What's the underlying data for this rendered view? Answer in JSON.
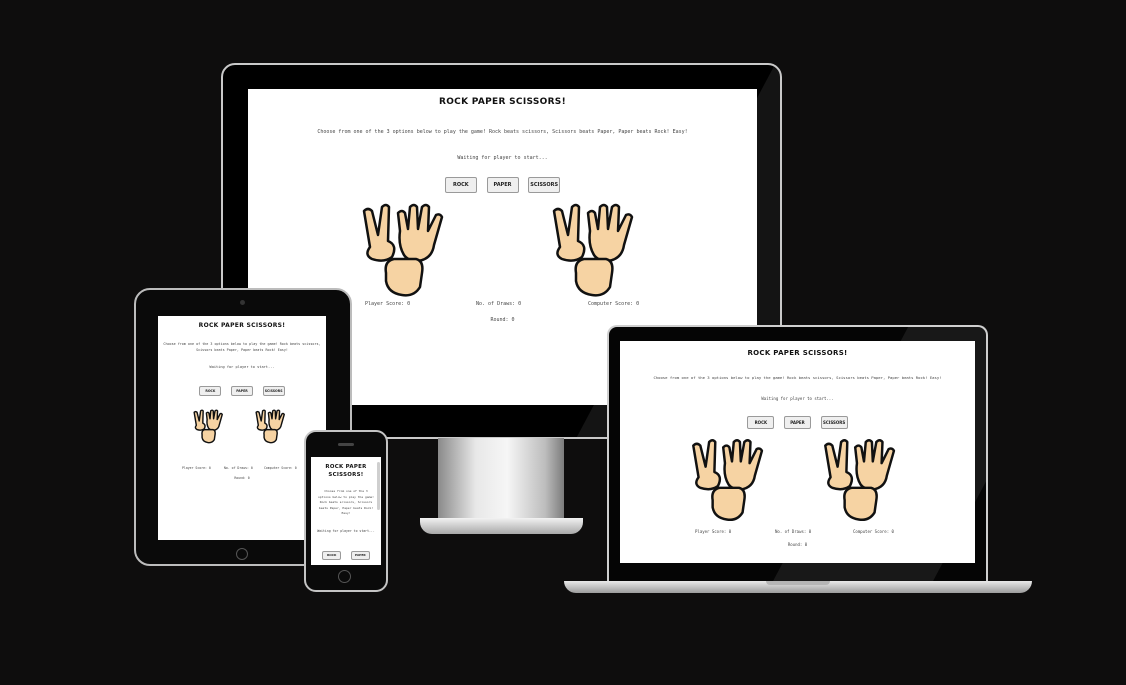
{
  "game": {
    "title": "ROCK PAPER SCISSORS!",
    "title_phone_line1": "ROCK PAPER",
    "title_phone_line2": "SCISSORS!",
    "intro": "Choose from one of the 3 options below to play the game! Rock beats scissors, Scissors beats Paper, Paper beats Rock! Easy!",
    "intro_tablet_line1": "Choose from one of the 3 options below to play the game! Rock beats scissors,",
    "intro_tablet_line2": "Scissors beats Paper, Paper beats Rock! Easy!",
    "intro_phone_lines": [
      "Choose from one of the 3",
      "options below to play the game!",
      "Rock beats scissors, Scissors",
      "beats Paper, Paper beats Rock!",
      "Easy!"
    ],
    "status": "Waiting for player to start...",
    "buttons": {
      "rock": "ROCK",
      "paper": "PAPER",
      "scissors": "SCISSORS"
    },
    "scores": {
      "player": "Player Score: 0",
      "draws": "No. of Draws: 0",
      "computer": "Computer Score: 0",
      "round": "Round: 0"
    },
    "hand_emojis": {
      "scissors": "✌",
      "paper": "🖐",
      "rock": "✊"
    },
    "skin_color": "#f6d3a3"
  },
  "colors": {
    "background": "#0e0d0d",
    "screen": "#ffffff",
    "button_bg": "#efefef"
  }
}
